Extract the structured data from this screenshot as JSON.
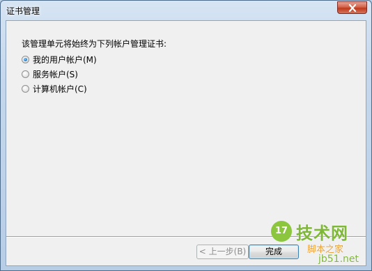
{
  "window": {
    "title": "证书管理"
  },
  "dialog": {
    "prompt": "该管理单元将始终为下列帐户管理证书:",
    "options": [
      {
        "label": "我的用户帐户(M)",
        "checked": true
      },
      {
        "label": "服务帐户(S)",
        "checked": false
      },
      {
        "label": "计算机帐户(C)",
        "checked": false
      }
    ]
  },
  "buttons": {
    "back": "< 上一步(B)",
    "finish": "完成"
  },
  "watermark": {
    "logo": "17",
    "line1": "技术网",
    "line2": "脚本之家",
    "line3": "jb51.net"
  },
  "colors": {
    "titlebar": "#c4d7ec",
    "client": "#f0f0f0",
    "close_button": "#c0391c",
    "radio_checked": "#2a7fc8",
    "watermark_green": "#7fb738",
    "watermark_orange": "#e8a13b"
  }
}
